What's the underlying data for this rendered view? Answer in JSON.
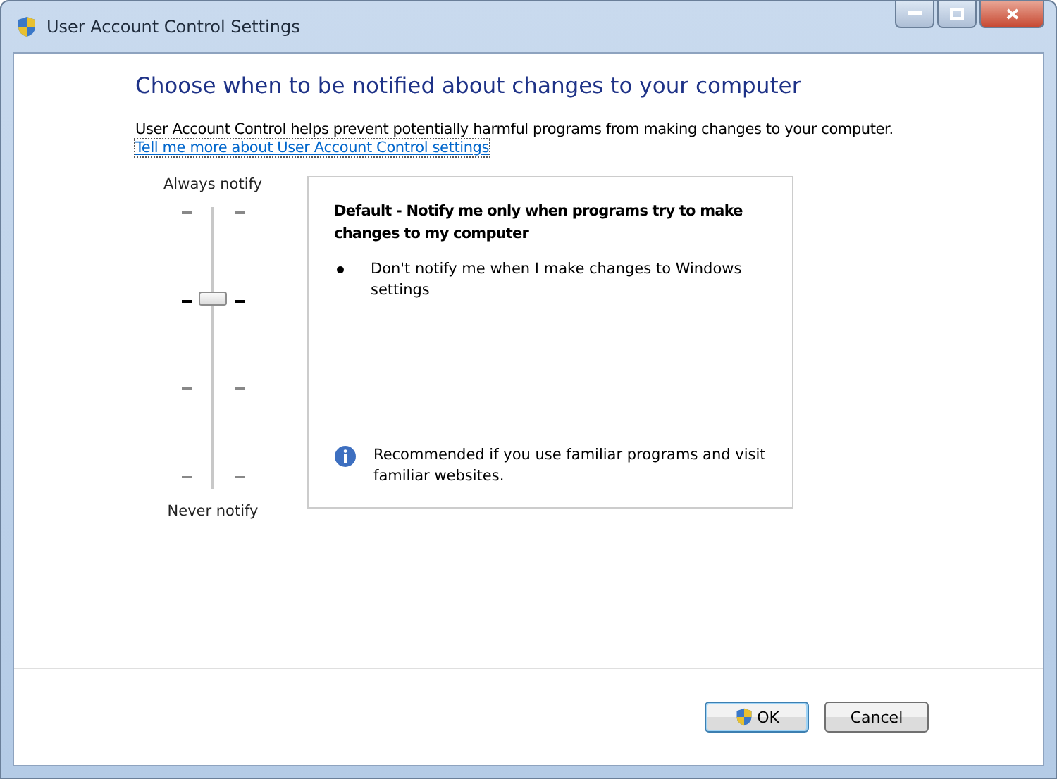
{
  "window": {
    "title": "User Account Control Settings"
  },
  "heading": "Choose when to be notified about changes to your computer",
  "intro": "User Account Control helps prevent potentially harmful programs from making changes to your computer.",
  "link": "Tell me more about User Account Control settings",
  "slider": {
    "top_label": "Always notify",
    "bottom_label": "Never notify",
    "level": 0.667
  },
  "description": {
    "title": "Default - Notify me only when programs try to make changes to my computer",
    "bullets": [
      "Don't notify me when I make changes to Windows settings"
    ],
    "note": "Recommended if you use familiar programs and visit familiar websites."
  },
  "buttons": [
    {
      "label": "OK",
      "kind": "shield",
      "default": true
    },
    {
      "label": "Cancel",
      "kind": "plain",
      "default": false
    }
  ]
}
